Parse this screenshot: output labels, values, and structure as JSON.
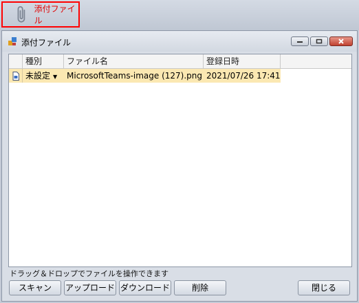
{
  "toolbar": {
    "attach_label": "添付ファイル"
  },
  "dialog": {
    "title": "添付ファイル",
    "columns": [
      "種別",
      "ファイル名",
      "登録日時"
    ],
    "rows": [
      {
        "type": "未設定",
        "filename": "MicrosoftTeams-image (127).png",
        "registered": "2021/07/26 17:41"
      }
    ],
    "hint": "ドラッグ＆ドロップでファイルを操作できます",
    "buttons": {
      "scan": "スキャン",
      "upload": "アップロード",
      "download": "ダウンロード",
      "delete": "削除",
      "close": "閉じる"
    }
  },
  "colors": {
    "highlight_border": "#ff0000",
    "selected_row": "#fbe8b2"
  }
}
